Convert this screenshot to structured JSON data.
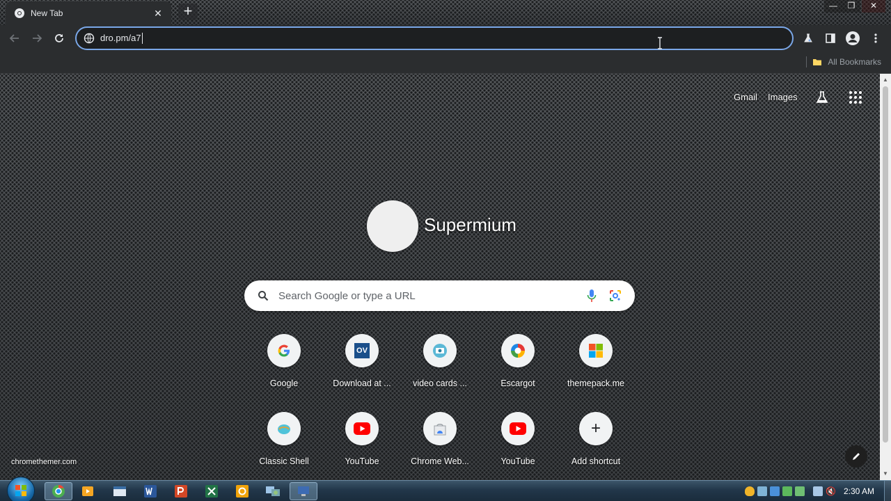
{
  "tab": {
    "title": "New Tab",
    "close": "✕"
  },
  "new_tab": "+",
  "window_controls": {
    "minimize": "—",
    "restore": "❐",
    "close": "✕"
  },
  "omnibox": {
    "url": "dro.pm/a7"
  },
  "bookmarks": {
    "all_bookmarks": "All Bookmarks"
  },
  "ntp": {
    "links": {
      "gmail": "Gmail",
      "images": "Images"
    },
    "brand": "Supermium",
    "search_placeholder": "Search Google or type a URL",
    "shortcuts": [
      {
        "label": "Google",
        "icon": "google-g-icon"
      },
      {
        "label": "Download at ...",
        "icon": "ov-icon",
        "icon_text": "OV"
      },
      {
        "label": "video cards ...",
        "icon": "video-card-icon"
      },
      {
        "label": "Escargot",
        "icon": "escargot-icon"
      },
      {
        "label": "themepack.me",
        "icon": "windows-flag-icon"
      },
      {
        "label": "Classic Shell",
        "icon": "classic-shell-icon"
      },
      {
        "label": "YouTube",
        "icon": "youtube-icon"
      },
      {
        "label": "Chrome Web...",
        "icon": "chrome-web-store-icon"
      },
      {
        "label": "YouTube",
        "icon": "youtube-icon"
      },
      {
        "label": "Add shortcut",
        "icon": "plus-icon",
        "icon_text": "+"
      }
    ],
    "footer_link": "chromethemer.com"
  },
  "taskbar": {
    "clock": "2:30 AM",
    "apps": [
      "chrome",
      "media-player",
      "app-3",
      "word",
      "powerpoint",
      "excel",
      "outlook",
      "network-app",
      "app-9"
    ]
  },
  "colors": {
    "accent": "#7aa7e8",
    "toolbar": "#2b2d2f",
    "youtube_red": "#ff0000",
    "ov_blue": "#1a4f8a"
  }
}
